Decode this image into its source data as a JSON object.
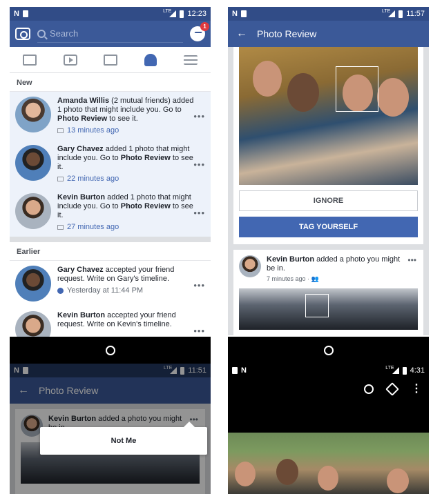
{
  "panel1": {
    "status": {
      "carrier": "N",
      "network": "LTE",
      "time": "12:23"
    },
    "search_placeholder": "Search",
    "messenger_badge": "1",
    "sections": {
      "new": "New",
      "earlier": "Earlier"
    },
    "new_items": [
      {
        "name": "Amanda Willis",
        "mutual": " (2 mutual friends)",
        "text1": " added 1 photo that might include you. Go to ",
        "link": "Photo Review",
        "text2": " to see it.",
        "time": "13 minutes ago"
      },
      {
        "name": "Gary Chavez",
        "text1": " added 1 photo that might include you. Go to ",
        "link": "Photo Review",
        "text2": " to see it.",
        "time": "22 minutes ago"
      },
      {
        "name": "Kevin Burton",
        "text1": " added 1 photo that might include you. Go to ",
        "link": "Photo Review",
        "text2": " to see it.",
        "time": "27 minutes ago"
      }
    ],
    "earlier_items": [
      {
        "name": "Gary Chavez",
        "text1": " accepted your friend request. Write on Gary's timeline.",
        "time": "Yesterday at 11:44 PM"
      },
      {
        "name": "Kevin Burton",
        "text1": " accepted your friend request. Write on Kevin's timeline."
      }
    ]
  },
  "panel2": {
    "status": {
      "carrier": "N",
      "network": "LTE",
      "time": "11:57"
    },
    "title": "Photo Review",
    "ignore_label": "IGNORE",
    "tag_label": "TAG YOURSELF",
    "post": {
      "name": "Kevin Burton",
      "text": " added a photo you might be in.",
      "time": "7 minutes ago"
    }
  },
  "panel3": {
    "status": {
      "carrier": "N",
      "network": "LTE",
      "time": "11:51"
    },
    "title": "Photo Review",
    "post": {
      "name": "Kevin Burton",
      "text": " added a photo you might be in."
    },
    "popup_label": "Not Me"
  },
  "panel4": {
    "status": {
      "carrier": "N",
      "network": "LTE",
      "time": "4:31"
    }
  }
}
